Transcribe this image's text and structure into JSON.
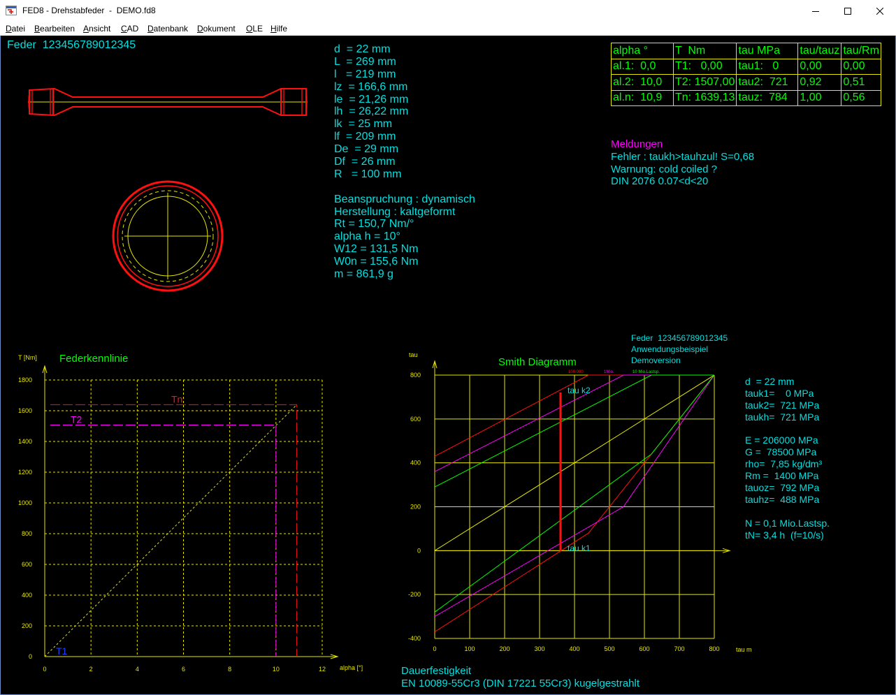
{
  "window": {
    "title": "FED8 - Drehstabfeder  -  DEMO.fd8"
  },
  "menu": [
    "Datei",
    "Bearbeiten",
    "Ansicht",
    "CAD",
    "Datenbank",
    "Dokument",
    "OLE",
    "Hilfe"
  ],
  "spring_title": "Feder  123456789012345",
  "dimensions": [
    "d  = 22 mm",
    "L  = 269 mm",
    "l   = 219 mm",
    "lz  = 166,6 mm",
    "le  = 21,26 mm",
    "lh  = 26,22 mm",
    "lk  = 25 mm",
    "lf  = 209 mm",
    "De  = 29 mm",
    "Df  = 26 mm",
    "R   = 100 mm"
  ],
  "load_info": [
    "Beanspruchung : dynamisch",
    "Herstellung : kaltgeformt",
    "Rt = 150,7 Nm/°",
    "alpha h = 10°",
    "W12 = 131,5 Nm",
    "W0n = 155,6 Nm",
    "m = 861,9 g"
  ],
  "results_table": {
    "headers": [
      "alpha °",
      "T  Nm",
      "tau MPa",
      "tau/tauz",
      "tau/Rm"
    ],
    "rows": [
      [
        "al.1:  0,0",
        "T1:   0,00",
        "tau1:   0",
        "0,00",
        "0,00"
      ],
      [
        "al.2:  10,0",
        "T2: 1507,00",
        "tau2:  721",
        "0,92",
        "0,51"
      ],
      [
        "al.n:  10,9",
        "Tn: 1639,13",
        "tauz:  784",
        "1,00",
        "0,56"
      ]
    ]
  },
  "messages": {
    "title": "Meldungen",
    "lines": [
      "Fehler : taukh>tauhzul! S=0,68",
      "Warnung: cold coiled ?",
      "DIN 2076 0.07<d<20"
    ]
  },
  "federkennlinie": {
    "title": "Federkennlinie",
    "ylabel": "T [Nm]",
    "xlabel": "alpha [°]",
    "labels": {
      "tn": "Tn",
      "t2": "T2",
      "t1": "T1"
    }
  },
  "smith": {
    "title": "Smith Diagramm",
    "ylabel": "tau",
    "xlabel": "tau m",
    "info": [
      "Feder  123456789012345",
      "Anwendungsbeispiel",
      "Demoversion"
    ],
    "curve_labels": [
      "100.000",
      "1Mio.",
      "10 Mio.Lastsp."
    ],
    "tau_k2": "tau k2",
    "tau_k1": "tau k1"
  },
  "material_info": [
    "d  = 22 mm",
    "tauk1=    0 MPa",
    "tauk2=  721 MPa",
    "taukh=  721 MPa",
    "",
    "E = 206000 MPa",
    "G =  78500 MPa",
    "rho=  7,85 kg/dm³",
    "Rm =  1400 MPa",
    "tauoz=  792 MPa",
    "tauhz=  488 MPa",
    "",
    "N = 0,1 Mio.Lastsp.",
    "tN= 3,4 h  (f=10/s)"
  ],
  "footer": {
    "line1": "Dauerfestigkeit",
    "line2": "EN 10089-55Cr3 (DIN 17221 55Cr3) kugelgestrahlt"
  },
  "chart_data": [
    {
      "type": "line",
      "title": "Federkennlinie",
      "xlabel": "alpha [°]",
      "ylabel": "T [Nm]",
      "xlim": [
        0,
        12
      ],
      "ylim": [
        0,
        1800
      ],
      "x_ticks": [
        0,
        2,
        4,
        6,
        8,
        10,
        12
      ],
      "y_ticks": [
        0,
        200,
        400,
        600,
        800,
        1000,
        1200,
        1400,
        1600,
        1800
      ],
      "grid": true,
      "series": [
        {
          "x": [
            0,
            10.9
          ],
          "y": [
            0,
            1639.13
          ]
        }
      ],
      "markers": [
        {
          "name": "T1",
          "x": 0,
          "y": 0
        },
        {
          "name": "T2",
          "x": 10,
          "y": 1507
        },
        {
          "name": "Tn",
          "x": 10.9,
          "y": 1639.13
        }
      ]
    },
    {
      "type": "line",
      "title": "Smith Diagramm",
      "xlabel": "tau m",
      "ylabel": "tau",
      "xlim": [
        0,
        800
      ],
      "ylim": [
        -400,
        800
      ],
      "x_ticks": [
        0,
        100,
        200,
        300,
        400,
        500,
        600,
        700,
        800
      ],
      "y_ticks": [
        -400,
        -200,
        0,
        200,
        400,
        600,
        800
      ],
      "grid": true,
      "series": [
        {
          "name": "100.000",
          "x": [
            0,
            440,
            800
          ],
          "y": [
            430,
            800,
            800
          ]
        },
        {
          "name": "1Mio.",
          "x": [
            0,
            540,
            800
          ],
          "y": [
            360,
            800,
            800
          ]
        },
        {
          "name": "10 Mio.Lastsp.",
          "x": [
            0,
            620,
            800
          ],
          "y": [
            290,
            800,
            800
          ]
        },
        {
          "x": [
            0,
            800
          ],
          "y": [
            0,
            800
          ]
        },
        {
          "x": [
            0,
            440,
            800
          ],
          "y": [
            -370,
            80,
            800
          ]
        },
        {
          "x": [
            0,
            540,
            800
          ],
          "y": [
            -300,
            200,
            800
          ]
        },
        {
          "x": [
            0,
            620,
            800
          ],
          "y": [
            -280,
            440,
            800
          ]
        },
        {
          "x": [
            360,
            360
          ],
          "y": [
            0,
            721
          ]
        }
      ]
    }
  ]
}
